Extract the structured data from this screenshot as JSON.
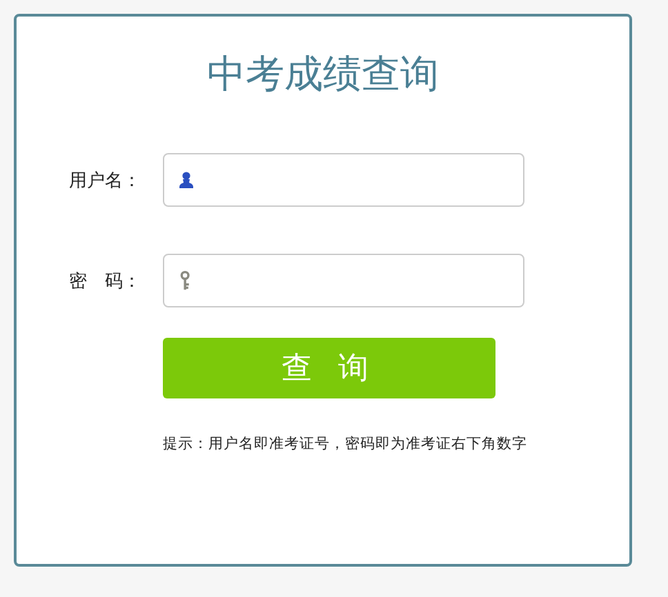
{
  "title": "中考成绩查询",
  "fields": [
    {
      "label": "用户名：",
      "kind": "user"
    },
    {
      "label": "密　码：",
      "kind": "password"
    }
  ],
  "submit_button": "查 询",
  "hint": "提示：用户名即准考证号，密码即为准考证右下角数字"
}
